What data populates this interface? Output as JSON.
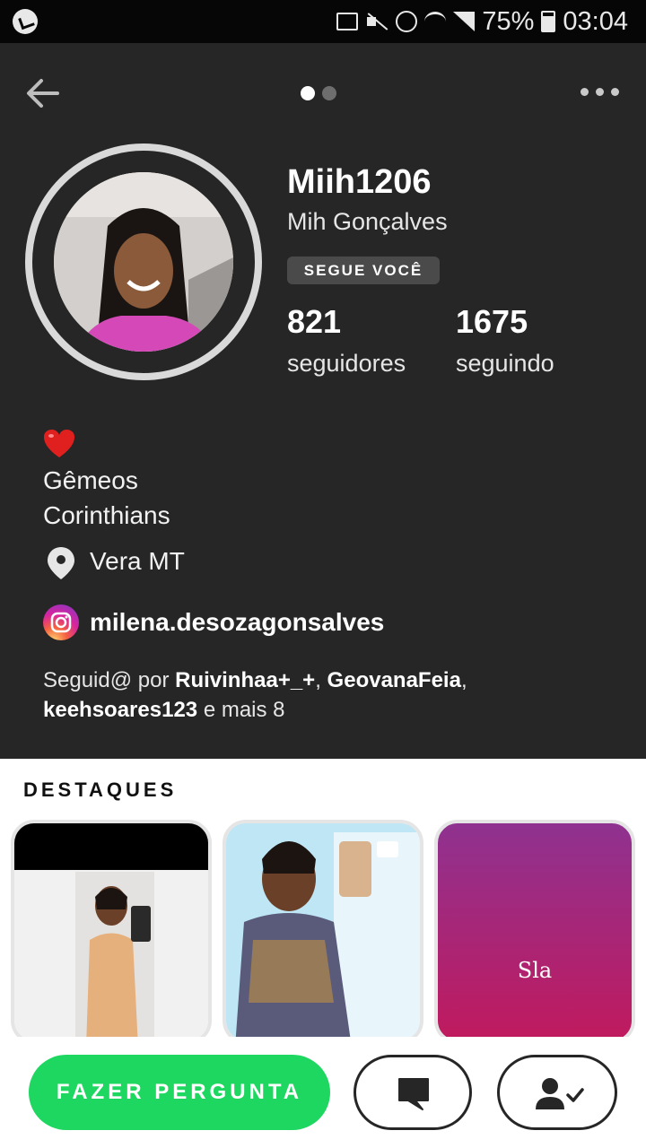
{
  "status_bar": {
    "battery": "75%",
    "time": "03:04"
  },
  "profile": {
    "username": "Miih1206",
    "full_name": "Mih Gonçalves",
    "follows_you_badge": "SEGUE VOCÊ",
    "stats": {
      "followers_count": "821",
      "followers_label": "seguidores",
      "following_count": "1675",
      "following_label": "seguindo"
    },
    "bio": [
      "Gêmeos",
      "Corinthians"
    ],
    "location": "Vera MT",
    "instagram": "milena.desozagonsalves",
    "followed_by": {
      "prefix": "Seguid@ por",
      "names": [
        "Ruivinhaa+_+",
        "GeovanaFeia",
        "keehsoares123"
      ],
      "suffix": "e mais 8"
    }
  },
  "pager": {
    "pages": 2,
    "active": 1
  },
  "highlights": {
    "title": "DESTAQUES",
    "items": [
      {
        "label": ""
      },
      {
        "label": ""
      },
      {
        "label": "Sla"
      }
    ]
  },
  "actions": {
    "ask_label": "FAZER PERGUNTA"
  },
  "colors": {
    "header_bg": "#262626",
    "accent_green": "#1ed760",
    "badge_bg": "#4a4a4a",
    "heart": "#e0201f"
  },
  "icons": [
    "back-arrow-icon",
    "more-icon",
    "heart-icon",
    "location-pin-icon",
    "instagram-icon",
    "chat-bubble-icon",
    "user-check-icon"
  ]
}
